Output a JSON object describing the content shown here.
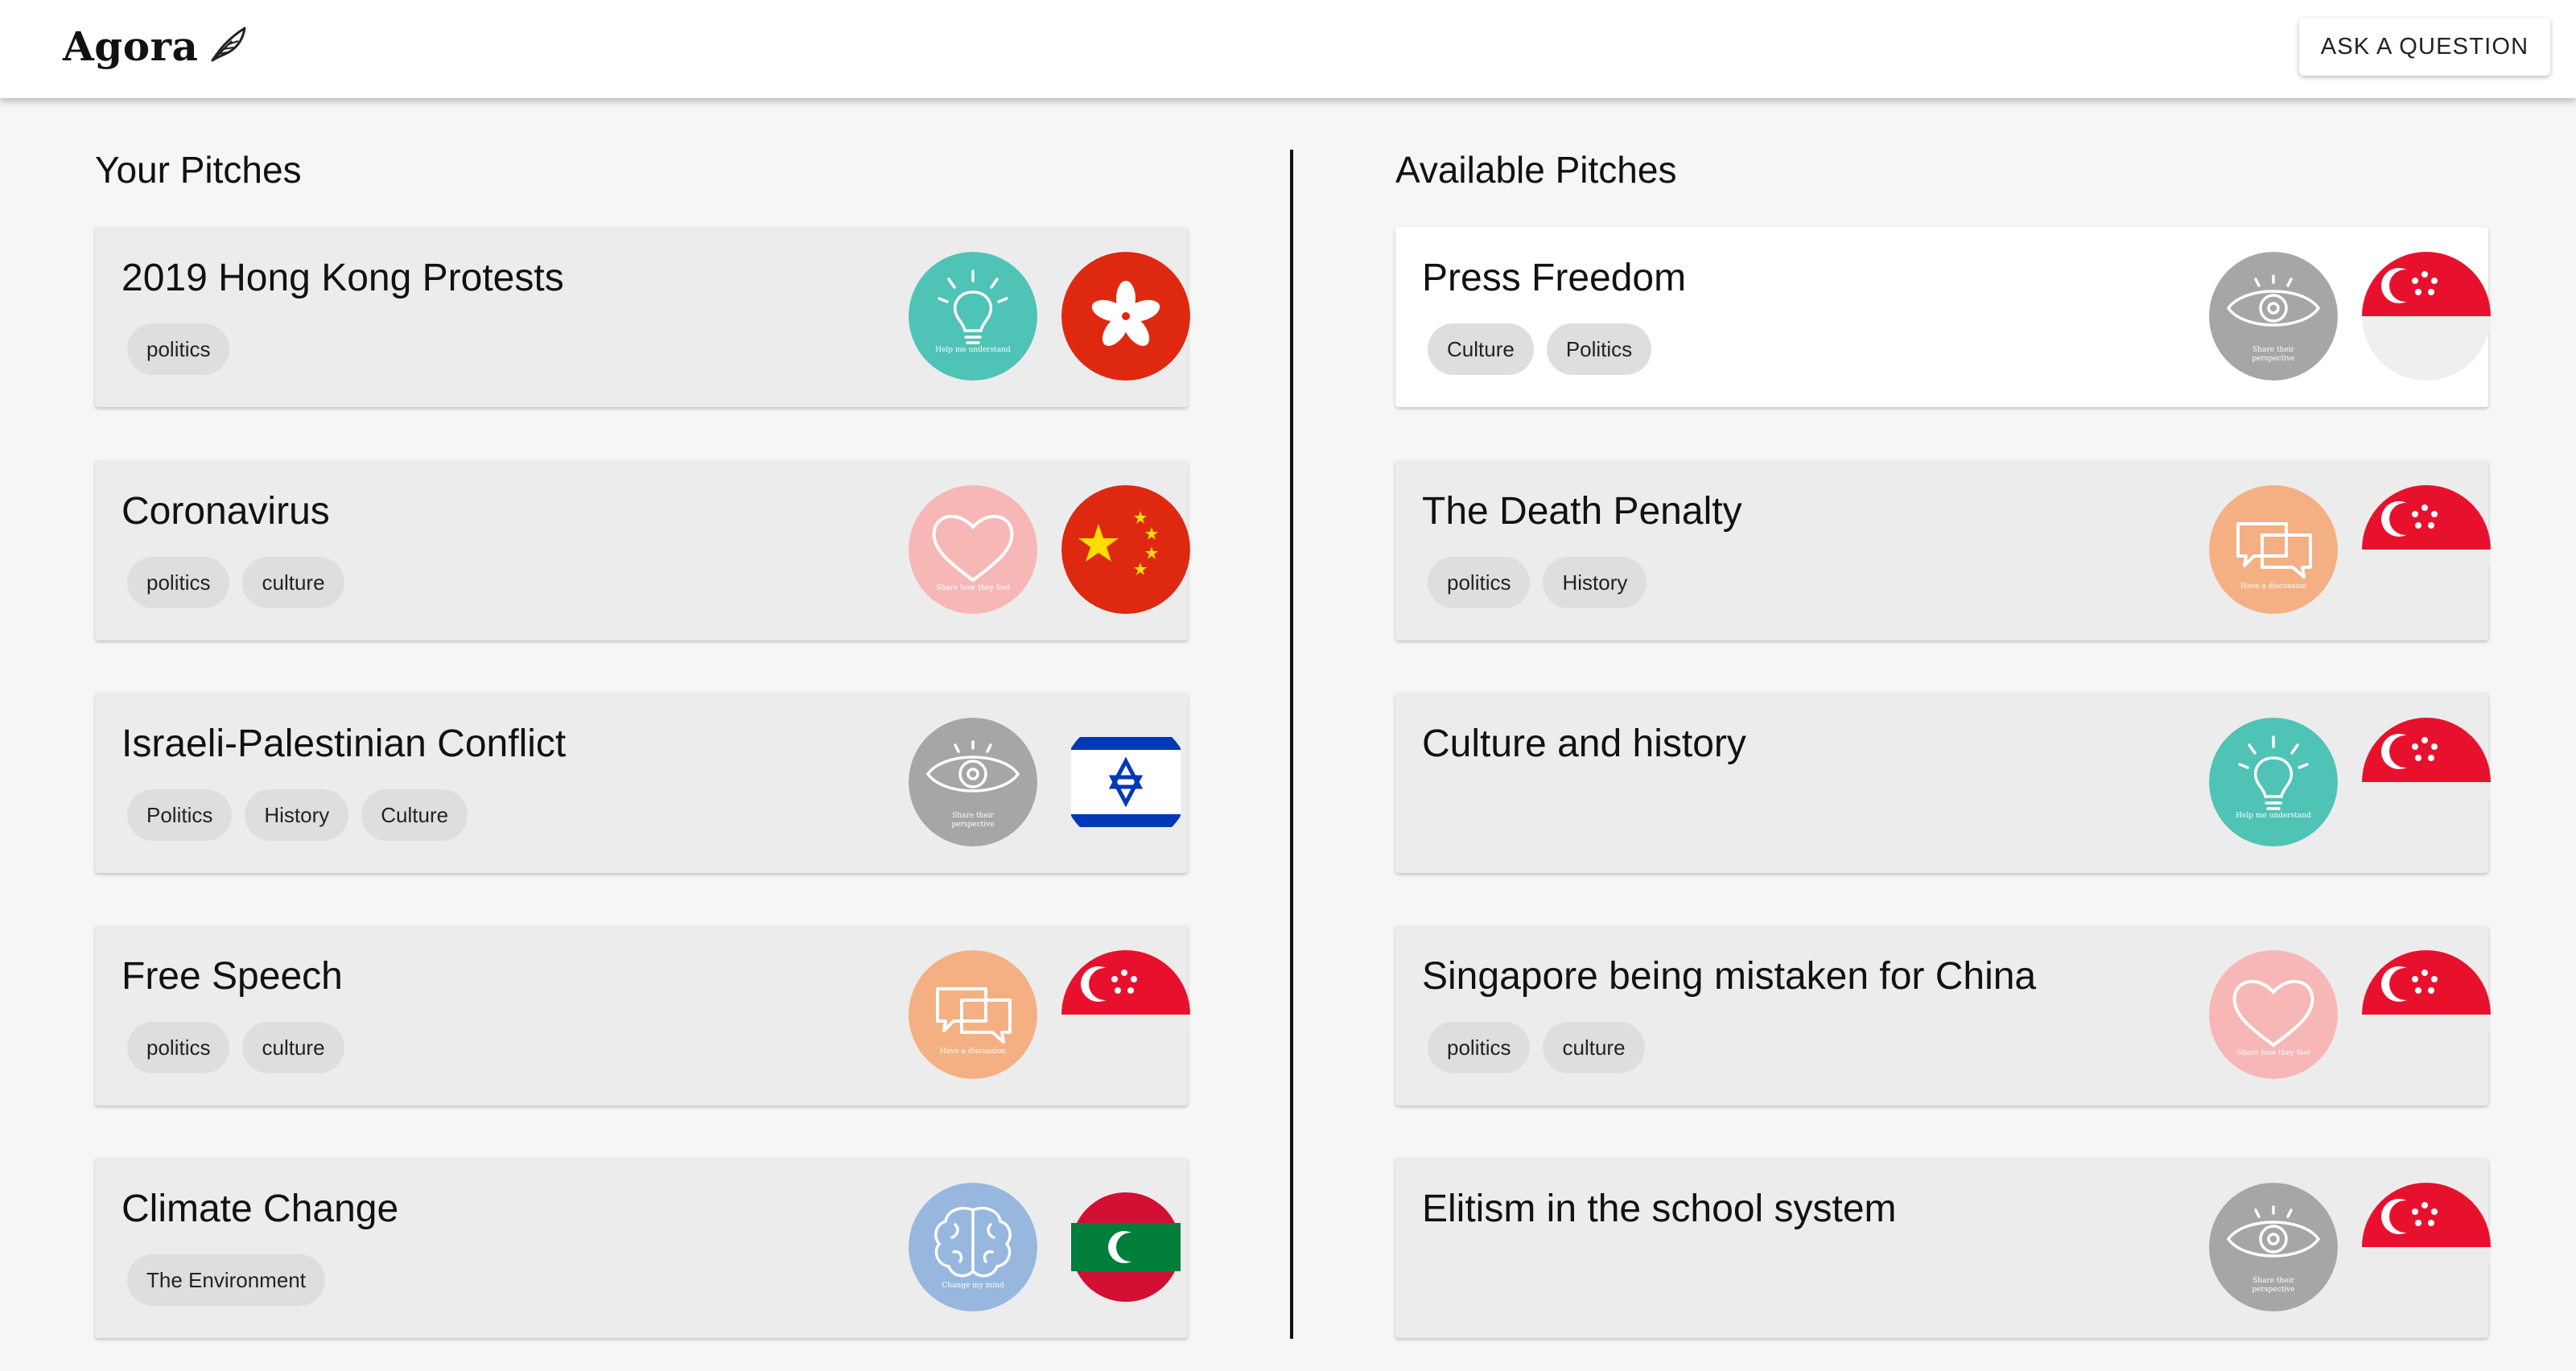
{
  "brand": {
    "name": "Agora",
    "icon": "feather-icon"
  },
  "header": {
    "ask_label": "ASK A QUESTION"
  },
  "columns": {
    "left_title": "Your Pitches",
    "right_title": "Available Pitches"
  },
  "your_pitches": [
    {
      "title": "2019 Hong Kong Protests",
      "tags": [
        "politics"
      ],
      "type_icon": "lightbulb-icon",
      "type_label": "Help me understand",
      "flag": "hong-kong-flag"
    },
    {
      "title": "Coronavirus",
      "tags": [
        "politics",
        "culture"
      ],
      "type_icon": "heart-icon",
      "type_label": "Share how they feel",
      "flag": "china-flag"
    },
    {
      "title": "Israeli-Palestinian Conflict",
      "tags": [
        "Politics",
        "History",
        "Culture"
      ],
      "type_icon": "eye-icon",
      "type_label": "Share their perspective",
      "flag": "israel-flag"
    },
    {
      "title": "Free Speech",
      "tags": [
        "politics",
        "culture"
      ],
      "type_icon": "chat-bubbles-icon",
      "type_label": "Have a discussion",
      "flag": "singapore-flag"
    },
    {
      "title": "Climate Change",
      "tags": [
        "The Environment"
      ],
      "type_icon": "brain-icon",
      "type_label": "Change my mind",
      "flag": "maldives-flag"
    }
  ],
  "available_pitches": [
    {
      "title": "Press Freedom",
      "tags": [
        "Culture",
        "Politics"
      ],
      "type_icon": "eye-icon",
      "type_label": "Share their perspective",
      "flag": "singapore-flag"
    },
    {
      "title": "The Death Penalty",
      "tags": [
        "politics",
        "History"
      ],
      "type_icon": "chat-bubbles-icon",
      "type_label": "Have a discussion",
      "flag": "singapore-flag"
    },
    {
      "title": "Culture and history",
      "tags": [],
      "type_icon": "lightbulb-icon",
      "type_label": "Help me understand",
      "flag": "singapore-flag"
    },
    {
      "title": "Singapore being mistaken for China",
      "tags": [
        "politics",
        "culture"
      ],
      "type_icon": "heart-icon",
      "type_label": "Share how they feel",
      "flag": "singapore-flag"
    },
    {
      "title": "Elitism in the school system",
      "tags": [],
      "type_icon": "eye-icon",
      "type_label": "Share their perspective",
      "flag": "singapore-flag"
    }
  ],
  "colors": {
    "teal": "#4fc3b5",
    "pink": "#f6b7b6",
    "grey": "#a6a6a6",
    "orange": "#f4b083",
    "blue": "#97b7df",
    "red": "#de2910",
    "sg_red": "#e8112d"
  }
}
